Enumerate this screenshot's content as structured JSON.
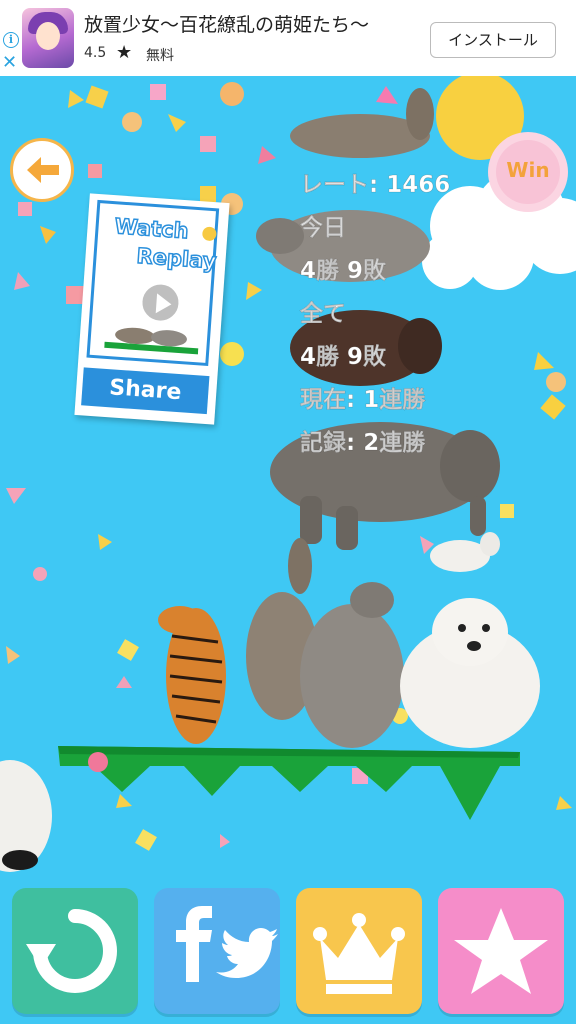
{
  "ad": {
    "title": "放置少女〜百花繚乱の萌姫たち〜",
    "rating": "4.5",
    "star": "★",
    "price": "無料",
    "install_label": "インストール",
    "info_icon": "info-icon",
    "close_icon": "close-icon"
  },
  "hud": {
    "back_icon": "back-arrow-icon",
    "win_label": "Win"
  },
  "replay": {
    "watch_label": "Watch",
    "replay_label": "Replay",
    "share_label": "Share",
    "play_icon": "play-icon"
  },
  "stats": {
    "rate": "レート: 1466",
    "today_label": "今日",
    "today_record": "4勝 9敗",
    "total_label": "全て",
    "total_record": "4勝 9敗",
    "current_streak": "現在: 1連勝",
    "best_streak": "記録: 2連勝"
  },
  "buttons": {
    "restart_icon": "restart-icon",
    "social_icons": [
      "facebook-icon",
      "twitter-icon"
    ],
    "ranking_icon": "crown-icon",
    "review_icon": "star-icon"
  },
  "colors": {
    "background": "#3fc8f4",
    "accent_blue": "#2b90dc",
    "restart": "#3fbf9f",
    "social": "#55b0ee",
    "ranking": "#f8c64d",
    "review": "#f58dc9",
    "grass": "#1aa33a"
  },
  "scene": {
    "animals": [
      "donkey",
      "rhinoceros",
      "rhinoceros",
      "cow",
      "elephant",
      "goat",
      "tiger",
      "donkey",
      "rhinoceros",
      "polar-bear",
      "panda"
    ]
  }
}
